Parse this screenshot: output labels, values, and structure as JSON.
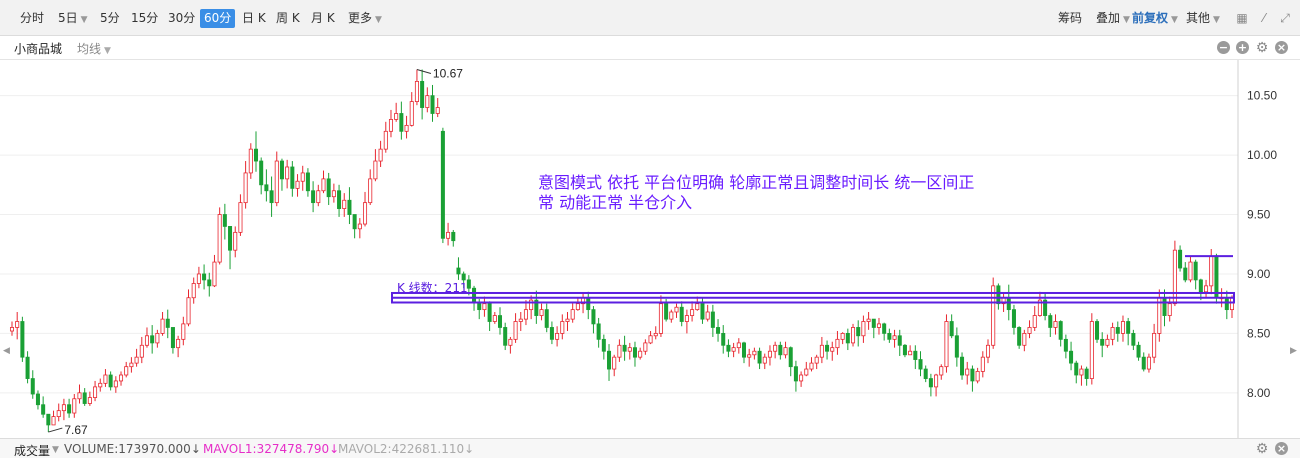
{
  "toolbar": {
    "periods": [
      {
        "label": "分时"
      },
      {
        "label": "5日",
        "dropdown": true
      },
      {
        "label": "5分"
      },
      {
        "label": "15分"
      },
      {
        "label": "30分"
      },
      {
        "label": "60分",
        "active": true
      },
      {
        "label": "日 K"
      },
      {
        "label": "周 K"
      },
      {
        "label": "月 K"
      },
      {
        "label": "更多",
        "dropdown": true
      }
    ],
    "right": {
      "chips_label": "筹码",
      "overlay_label": "叠加",
      "adjust_label": "前复权",
      "other_label": "其他"
    }
  },
  "stock": {
    "name": "小商品城",
    "indicator_label": "均线"
  },
  "chart_data": {
    "type": "candlestick",
    "y_ticks": [
      "10.50",
      "10.00",
      "9.50",
      "9.00",
      "8.50",
      "8.00"
    ],
    "ylim": [
      7.62,
      10.8
    ],
    "high_marker": "10.67",
    "low_marker": "7.67",
    "annotation": "意图模式 依托 平台位明确 轮廓正常且调整时间长 统一区间正常 动能正常 半仓介入",
    "box_label": "K 线数：211",
    "up_color": "#e8262f",
    "down_color": "#1aa035",
    "annotation_color": "#6a1cff",
    "box_color": "#5b1fe0",
    "candles": [
      [
        8.52,
        8.6,
        8.55,
        8.48
      ],
      [
        8.55,
        8.68,
        8.6,
        8.45
      ],
      [
        8.6,
        8.64,
        8.3,
        8.26
      ],
      [
        8.3,
        8.35,
        8.12,
        8.08
      ],
      [
        8.12,
        8.19,
        7.99,
        7.95
      ],
      [
        7.99,
        8.02,
        7.9,
        7.86
      ],
      [
        7.9,
        7.97,
        7.82,
        7.79
      ],
      [
        7.82,
        7.81,
        7.73,
        7.67
      ],
      [
        7.73,
        7.85,
        7.8,
        7.73
      ],
      [
        7.8,
        7.91,
        7.85,
        7.76
      ],
      [
        7.85,
        7.95,
        7.9,
        7.77
      ],
      [
        7.9,
        7.95,
        7.83,
        7.79
      ],
      [
        7.83,
        7.99,
        7.95,
        7.79
      ],
      [
        7.95,
        8.07,
        8.0,
        7.91
      ],
      [
        8.0,
        8.04,
        7.91,
        7.89
      ],
      [
        7.91,
        8.01,
        7.96,
        7.89
      ],
      [
        7.96,
        8.1,
        8.05,
        7.93
      ],
      [
        8.05,
        8.12,
        8.08,
        8.01
      ],
      [
        8.08,
        8.2,
        8.15,
        8.05
      ],
      [
        8.15,
        8.18,
        8.05,
        8.02
      ],
      [
        8.05,
        8.14,
        8.1,
        8.0
      ],
      [
        8.1,
        8.18,
        8.15,
        8.06
      ],
      [
        8.15,
        8.26,
        8.22,
        8.13
      ],
      [
        8.22,
        8.3,
        8.25,
        8.17
      ],
      [
        8.25,
        8.37,
        8.3,
        8.22
      ],
      [
        8.3,
        8.47,
        8.4,
        8.25
      ],
      [
        8.4,
        8.55,
        8.48,
        8.38
      ],
      [
        8.48,
        8.57,
        8.42,
        8.33
      ],
      [
        8.42,
        8.53,
        8.5,
        8.38
      ],
      [
        8.5,
        8.68,
        8.62,
        8.48
      ],
      [
        8.62,
        8.7,
        8.55,
        8.46
      ],
      [
        8.55,
        8.48,
        8.38,
        8.33
      ],
      [
        8.38,
        8.48,
        8.45,
        8.3
      ],
      [
        8.45,
        8.64,
        8.58,
        8.4
      ],
      [
        8.58,
        8.87,
        8.8,
        8.56
      ],
      [
        8.8,
        8.97,
        8.92,
        8.75
      ],
      [
        8.92,
        9.06,
        9.0,
        8.88
      ],
      [
        9.0,
        9.08,
        8.95,
        8.87
      ],
      [
        8.95,
        9.01,
        8.9,
        8.81
      ],
      [
        8.9,
        9.16,
        9.1,
        8.89
      ],
      [
        9.1,
        9.56,
        9.5,
        9.08
      ],
      [
        9.5,
        9.59,
        9.4,
        9.29
      ],
      [
        9.4,
        9.29,
        9.2,
        9.04
      ],
      [
        9.2,
        9.4,
        9.35,
        9.14
      ],
      [
        9.35,
        9.67,
        9.6,
        9.32
      ],
      [
        9.6,
        9.95,
        9.85,
        9.55
      ],
      [
        9.85,
        10.1,
        10.05,
        9.8
      ],
      [
        10.05,
        10.2,
        9.95,
        9.86
      ],
      [
        9.95,
        9.98,
        9.75,
        9.67
      ],
      [
        9.75,
        9.88,
        9.7,
        9.61
      ],
      [
        9.7,
        9.82,
        9.6,
        9.48
      ],
      [
        9.6,
        10.03,
        9.95,
        9.57
      ],
      [
        9.95,
        9.97,
        9.8,
        9.7
      ],
      [
        9.8,
        9.96,
        9.9,
        9.72
      ],
      [
        9.9,
        9.95,
        9.72,
        9.65
      ],
      [
        9.72,
        9.84,
        9.78,
        9.65
      ],
      [
        9.78,
        9.91,
        9.85,
        9.7
      ],
      [
        9.85,
        9.89,
        9.7,
        9.65
      ],
      [
        9.7,
        9.78,
        9.6,
        9.52
      ],
      [
        9.6,
        9.75,
        9.7,
        9.57
      ],
      [
        9.7,
        9.87,
        9.8,
        9.68
      ],
      [
        9.8,
        9.85,
        9.65,
        9.58
      ],
      [
        9.65,
        9.76,
        9.7,
        9.6
      ],
      [
        9.7,
        9.75,
        9.55,
        9.48
      ],
      [
        9.55,
        9.68,
        9.62,
        9.48
      ],
      [
        9.62,
        9.73,
        9.5,
        9.42
      ],
      [
        9.5,
        9.44,
        9.38,
        9.3
      ],
      [
        9.38,
        9.47,
        9.42,
        9.3
      ],
      [
        9.42,
        9.69,
        9.6,
        9.4
      ],
      [
        9.6,
        9.88,
        9.8,
        9.58
      ],
      [
        9.8,
        10.05,
        9.95,
        9.78
      ],
      [
        9.95,
        10.12,
        10.05,
        9.9
      ],
      [
        10.05,
        10.28,
        10.2,
        10.02
      ],
      [
        10.2,
        10.38,
        10.3,
        10.15
      ],
      [
        10.3,
        10.44,
        10.35,
        10.28
      ],
      [
        10.35,
        10.45,
        10.2,
        10.13
      ],
      [
        10.2,
        10.33,
        10.25,
        10.14
      ],
      [
        10.25,
        10.53,
        10.45,
        10.24
      ],
      [
        10.45,
        10.72,
        10.62,
        10.42
      ],
      [
        10.62,
        10.72,
        10.4,
        10.3
      ],
      [
        10.4,
        10.57,
        10.5,
        10.36
      ],
      [
        10.5,
        10.59,
        10.35,
        10.28
      ],
      [
        10.35,
        10.48,
        10.4,
        10.32
      ],
      [
        10.2,
        10.23,
        9.3,
        9.26
      ],
      [
        9.3,
        9.43,
        9.35,
        9.24
      ],
      [
        9.35,
        9.37,
        9.28,
        9.23
      ],
      [
        9.05,
        9.14,
        9.0,
        8.95
      ],
      [
        9.0,
        9.02,
        8.95,
        8.88
      ],
      [
        8.95,
        8.99,
        8.88,
        8.82
      ],
      [
        8.88,
        8.9,
        8.76,
        8.69
      ],
      [
        8.76,
        8.79,
        8.7,
        8.62
      ],
      [
        8.7,
        8.81,
        8.75,
        8.64
      ],
      [
        8.75,
        8.77,
        8.6,
        8.52
      ],
      [
        8.6,
        8.68,
        8.65,
        8.58
      ],
      [
        8.65,
        8.72,
        8.55,
        8.49
      ],
      [
        8.55,
        8.59,
        8.4,
        8.36
      ],
      [
        8.4,
        8.47,
        8.45,
        8.33
      ],
      [
        8.45,
        8.67,
        8.6,
        8.42
      ],
      [
        8.6,
        8.68,
        8.62,
        8.52
      ],
      [
        8.62,
        8.78,
        8.7,
        8.57
      ],
      [
        8.7,
        8.82,
        8.78,
        8.62
      ],
      [
        8.78,
        8.86,
        8.65,
        8.58
      ],
      [
        8.65,
        8.75,
        8.7,
        8.61
      ],
      [
        8.7,
        8.75,
        8.55,
        8.51
      ],
      [
        8.55,
        8.6,
        8.45,
        8.41
      ],
      [
        8.45,
        8.56,
        8.5,
        8.39
      ],
      [
        8.5,
        8.66,
        8.6,
        8.45
      ],
      [
        8.6,
        8.68,
        8.62,
        8.52
      ],
      [
        8.62,
        8.76,
        8.7,
        8.59
      ],
      [
        8.7,
        8.8,
        8.75,
        8.69
      ],
      [
        8.75,
        8.84,
        8.8,
        8.67
      ],
      [
        8.8,
        8.85,
        8.7,
        8.62
      ],
      [
        8.7,
        8.73,
        8.58,
        8.5
      ],
      [
        8.58,
        8.63,
        8.45,
        8.38
      ],
      [
        8.45,
        8.49,
        8.35,
        8.28
      ],
      [
        8.35,
        8.41,
        8.2,
        8.1
      ],
      [
        8.2,
        8.32,
        8.3,
        8.14
      ],
      [
        8.3,
        8.45,
        8.4,
        8.26
      ],
      [
        8.4,
        8.48,
        8.35,
        8.27
      ],
      [
        8.35,
        8.42,
        8.38,
        8.28
      ],
      [
        8.38,
        8.43,
        8.3,
        8.22
      ],
      [
        8.3,
        8.38,
        8.35,
        8.28
      ],
      [
        8.35,
        8.45,
        8.42,
        8.32
      ],
      [
        8.42,
        8.52,
        8.48,
        8.41
      ],
      [
        8.48,
        8.56,
        8.5,
        8.45
      ],
      [
        8.5,
        8.82,
        8.75,
        8.47
      ],
      [
        8.75,
        8.79,
        8.62,
        8.6
      ],
      [
        8.62,
        8.7,
        8.68,
        8.59
      ],
      [
        8.68,
        8.75,
        8.72,
        8.63
      ],
      [
        8.72,
        8.77,
        8.6,
        8.56
      ],
      [
        8.6,
        8.7,
        8.65,
        8.5
      ],
      [
        8.65,
        8.77,
        8.7,
        8.6
      ],
      [
        8.7,
        8.81,
        8.75,
        8.69
      ],
      [
        8.75,
        8.8,
        8.62,
        8.58
      ],
      [
        8.62,
        8.74,
        8.68,
        8.6
      ],
      [
        8.68,
        8.74,
        8.55,
        8.47
      ],
      [
        8.55,
        8.62,
        8.5,
        8.43
      ],
      [
        8.5,
        8.57,
        8.4,
        8.33
      ],
      [
        8.4,
        8.45,
        8.35,
        8.3
      ],
      [
        8.35,
        8.42,
        8.38,
        8.3
      ],
      [
        8.38,
        8.46,
        8.42,
        8.33
      ],
      [
        8.42,
        8.43,
        8.3,
        8.25
      ],
      [
        8.3,
        8.37,
        8.32,
        8.22
      ],
      [
        8.32,
        8.38,
        8.35,
        8.28
      ],
      [
        8.35,
        8.38,
        8.25,
        8.2
      ],
      [
        8.25,
        8.33,
        8.3,
        8.2
      ],
      [
        8.3,
        8.4,
        8.35,
        8.23
      ],
      [
        8.35,
        8.43,
        8.4,
        8.29
      ],
      [
        8.4,
        8.43,
        8.32,
        8.28
      ],
      [
        8.32,
        8.43,
        8.38,
        8.29
      ],
      [
        8.38,
        8.39,
        8.22,
        8.14
      ],
      [
        8.22,
        8.27,
        8.1,
        8.01
      ],
      [
        8.1,
        8.18,
        8.15,
        8.05
      ],
      [
        8.15,
        8.26,
        8.2,
        8.14
      ],
      [
        8.2,
        8.3,
        8.25,
        8.18
      ],
      [
        8.25,
        8.32,
        8.3,
        8.2
      ],
      [
        8.3,
        8.47,
        8.4,
        8.25
      ],
      [
        8.4,
        8.44,
        8.35,
        8.28
      ],
      [
        8.35,
        8.43,
        8.38,
        8.27
      ],
      [
        8.38,
        8.52,
        8.45,
        8.32
      ],
      [
        8.45,
        8.51,
        8.5,
        8.41
      ],
      [
        8.5,
        8.54,
        8.42,
        8.36
      ],
      [
        8.42,
        8.58,
        8.55,
        8.39
      ],
      [
        8.55,
        8.61,
        8.48,
        8.39
      ],
      [
        8.48,
        8.65,
        8.6,
        8.42
      ],
      [
        8.6,
        8.68,
        8.62,
        8.53
      ],
      [
        8.62,
        8.62,
        8.55,
        8.46
      ],
      [
        8.55,
        8.63,
        8.58,
        8.49
      ],
      [
        8.58,
        8.59,
        8.5,
        8.44
      ],
      [
        8.5,
        8.54,
        8.45,
        8.42
      ],
      [
        8.45,
        8.53,
        8.48,
        8.38
      ],
      [
        8.48,
        8.53,
        8.4,
        8.31
      ],
      [
        8.4,
        8.41,
        8.32,
        8.3
      ],
      [
        8.32,
        8.4,
        8.35,
        8.32
      ],
      [
        8.35,
        8.4,
        8.28,
        8.2
      ],
      [
        8.28,
        8.35,
        8.2,
        8.14
      ],
      [
        8.2,
        8.23,
        8.12,
        8.09
      ],
      [
        8.12,
        8.16,
        8.05,
        7.97
      ],
      [
        8.05,
        8.16,
        8.15,
        7.97
      ],
      [
        8.15,
        8.24,
        8.22,
        8.11
      ],
      [
        8.22,
        8.66,
        8.6,
        8.17
      ],
      [
        8.6,
        8.66,
        8.48,
        8.46
      ],
      [
        8.48,
        8.55,
        8.3,
        8.22
      ],
      [
        8.3,
        8.34,
        8.15,
        8.11
      ],
      [
        8.15,
        8.26,
        8.2,
        8.07
      ],
      [
        8.2,
        8.23,
        8.1,
        8.01
      ],
      [
        8.1,
        8.21,
        8.18,
        8.08
      ],
      [
        8.18,
        8.35,
        8.3,
        8.13
      ],
      [
        8.3,
        8.45,
        8.4,
        8.25
      ],
      [
        8.4,
        8.97,
        8.9,
        8.37
      ],
      [
        8.9,
        8.92,
        8.75,
        8.7
      ],
      [
        8.75,
        8.84,
        8.8,
        8.68
      ],
      [
        8.8,
        8.91,
        8.7,
        8.61
      ],
      [
        8.7,
        8.74,
        8.55,
        8.49
      ],
      [
        8.55,
        8.56,
        8.4,
        8.37
      ],
      [
        8.4,
        8.53,
        8.5,
        8.35
      ],
      [
        8.5,
        8.61,
        8.55,
        8.46
      ],
      [
        8.55,
        8.73,
        8.65,
        8.52
      ],
      [
        8.65,
        8.85,
        8.78,
        8.64
      ],
      [
        8.78,
        8.84,
        8.65,
        8.61
      ],
      [
        8.65,
        8.67,
        8.55,
        8.47
      ],
      [
        8.55,
        8.66,
        8.6,
        8.49
      ],
      [
        8.6,
        8.61,
        8.45,
        8.39
      ],
      [
        8.45,
        8.49,
        8.35,
        8.29
      ],
      [
        8.35,
        8.43,
        8.25,
        8.19
      ],
      [
        8.25,
        8.27,
        8.15,
        8.08
      ],
      [
        8.15,
        8.23,
        8.2,
        8.06
      ],
      [
        8.2,
        8.22,
        8.12,
        8.06
      ],
      [
        8.12,
        8.67,
        8.6,
        8.07
      ],
      [
        8.6,
        8.62,
        8.45,
        8.42
      ],
      [
        8.45,
        8.51,
        8.4,
        8.3
      ],
      [
        8.4,
        8.49,
        8.45,
        8.38
      ],
      [
        8.45,
        8.59,
        8.55,
        8.4
      ],
      [
        8.55,
        8.6,
        8.5,
        8.43
      ],
      [
        8.5,
        8.65,
        8.6,
        8.43
      ],
      [
        8.6,
        8.63,
        8.5,
        8.4
      ],
      [
        8.5,
        8.53,
        8.4,
        8.36
      ],
      [
        8.4,
        8.43,
        8.3,
        8.27
      ],
      [
        8.3,
        8.34,
        8.2,
        8.18
      ],
      [
        8.2,
        8.33,
        8.3,
        8.17
      ],
      [
        8.3,
        8.58,
        8.5,
        8.25
      ],
      [
        8.5,
        8.87,
        8.8,
        8.43
      ],
      [
        8.8,
        8.87,
        8.65,
        8.56
      ],
      [
        8.65,
        8.81,
        8.75,
        8.6
      ],
      [
        8.75,
        9.28,
        9.2,
        8.73
      ],
      [
        9.2,
        9.24,
        9.05,
        9.02
      ],
      [
        9.05,
        9.1,
        8.95,
        8.93
      ],
      [
        8.95,
        9.15,
        9.1,
        8.93
      ],
      [
        9.1,
        9.12,
        8.95,
        8.87
      ],
      [
        8.95,
        8.96,
        8.85,
        8.78
      ],
      [
        8.85,
        8.95,
        8.9,
        8.8
      ],
      [
        8.9,
        9.21,
        9.15,
        8.83
      ],
      [
        9.15,
        9.17,
        8.8,
        8.75
      ],
      [
        8.8,
        8.88,
        8.8,
        8.72
      ],
      [
        8.8,
        8.86,
        8.7,
        8.62
      ],
      [
        8.7,
        8.82,
        8.8,
        8.63
      ]
    ]
  }
}
